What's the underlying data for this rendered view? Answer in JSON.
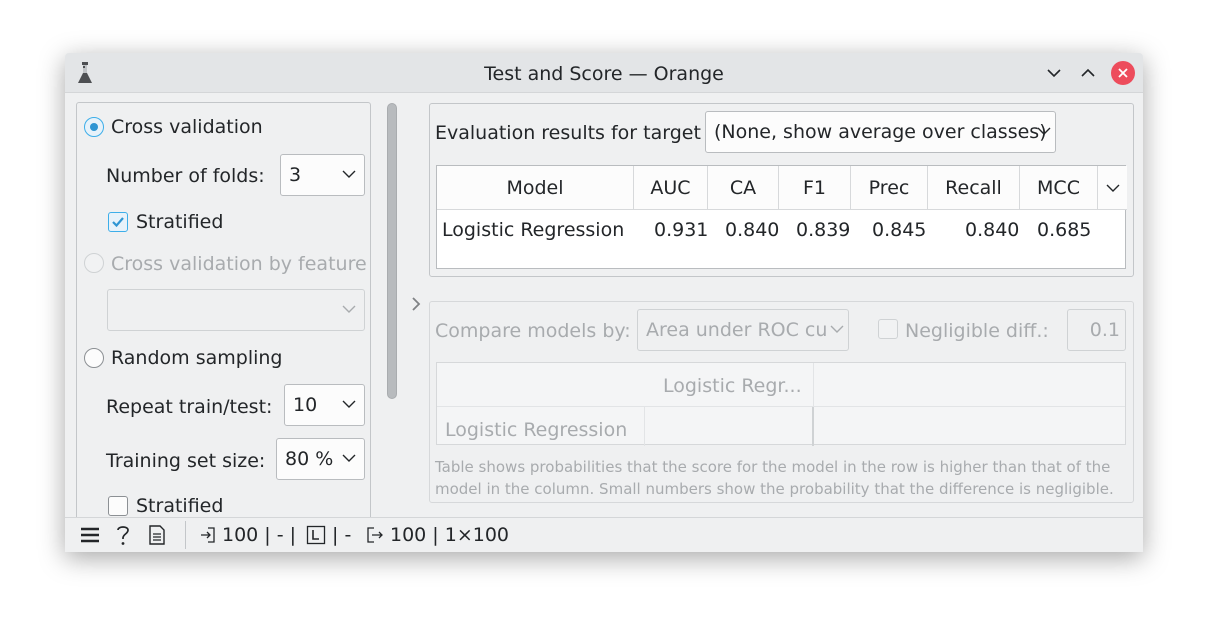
{
  "window": {
    "title": "Test and Score — Orange",
    "icons": [
      "flask-icon",
      "minimize-icon",
      "maximize-icon",
      "close-icon"
    ],
    "close_color": "#ed4c5c"
  },
  "sampling": {
    "cross_validation": {
      "label": "Cross validation",
      "selected": true
    },
    "folds": {
      "label": "Number of folds:",
      "value": "3"
    },
    "stratified_cv": {
      "label": "Stratified",
      "checked": true
    },
    "cv_by_feature": {
      "label": "Cross validation by feature",
      "enabled": false,
      "value": ""
    },
    "random_sampling": {
      "label": "Random sampling",
      "selected": false
    },
    "repeat": {
      "label": "Repeat train/test:",
      "value": "10"
    },
    "training_size": {
      "label": "Training set size:",
      "value": "80 %"
    },
    "stratified_rs": {
      "label": "Stratified",
      "checked": false
    }
  },
  "evaluation": {
    "target_label": "Evaluation results for target",
    "target_value": "(None, show average over classes)",
    "columns": [
      "Model",
      "AUC",
      "CA",
      "F1",
      "Prec",
      "Recall",
      "MCC"
    ],
    "rows": [
      {
        "model": "Logistic Regression",
        "auc": "0.931",
        "ca": "0.840",
        "f1": "0.839",
        "prec": "0.845",
        "recall": "0.840",
        "mcc": "0.685"
      }
    ]
  },
  "comparison": {
    "compare_label": "Compare models by:",
    "compare_value": "Area under ROC cu",
    "negligible_label": "Negligible diff.:",
    "negligible_checked": false,
    "negligible_value": "0.1",
    "column_header": "Logistic Regr...",
    "row_header": "Logistic Regression",
    "note": "Table shows probabilities that the score for the model in the row is higher than that of the model in the column. Small numbers show the probability that the difference is negligible."
  },
  "statusbar": {
    "input_count": "100 | - |",
    "label_sep": "| -",
    "output_count": "100 | 1×100",
    "icons": [
      "menu-icon",
      "help-icon",
      "report-icon",
      "input-icon",
      "learner-icon",
      "output-icon"
    ]
  },
  "colors": {
    "accent": "#3daee9",
    "background": "#eff0f1",
    "titlebar": "#e3e5e7"
  }
}
